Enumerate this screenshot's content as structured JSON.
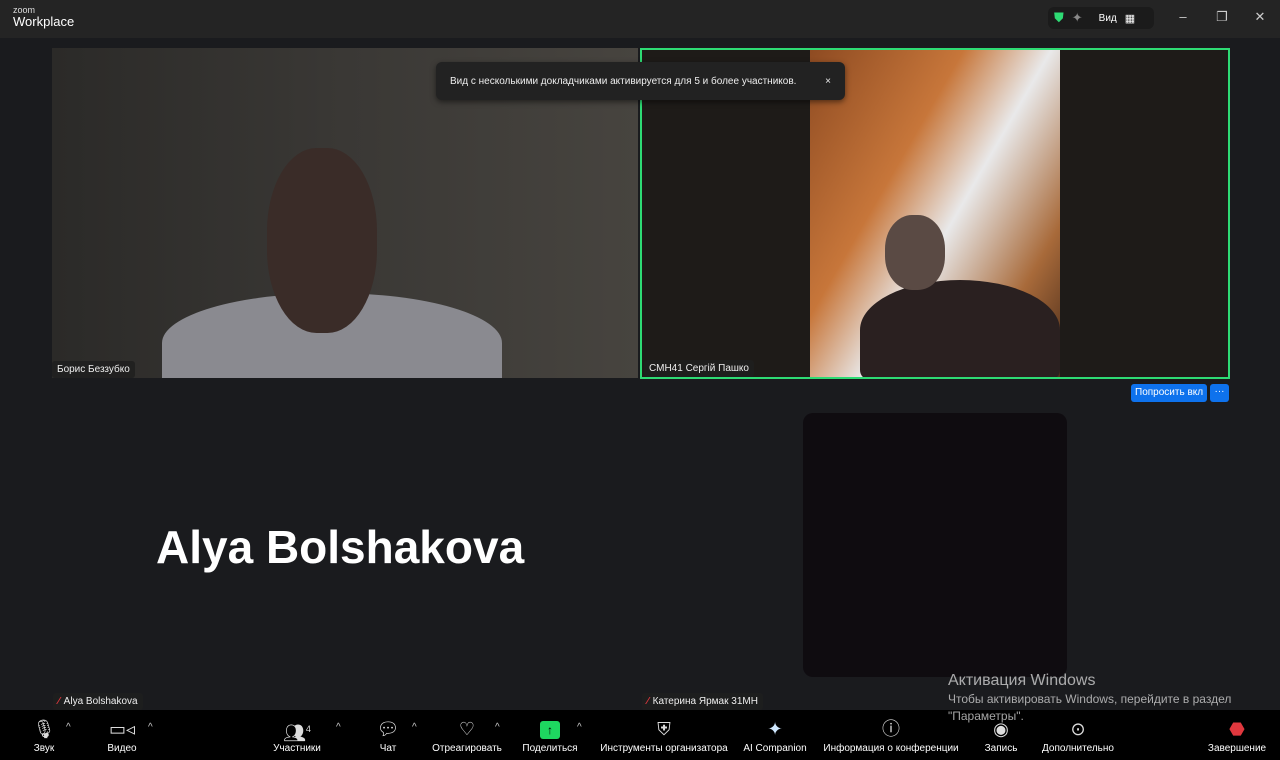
{
  "app": {
    "logo_small": "zoom",
    "logo_big": "Workplace",
    "view_label": "Вид"
  },
  "toast": {
    "text": "Вид с несколькими докладчиками активируется для 5 и более участников.",
    "close": "×"
  },
  "participants": [
    {
      "name": "Борис Беззубко"
    },
    {
      "name": "СМН41 Сергій Пашко"
    },
    {
      "name": "Alya Bolshakova",
      "muted": true
    },
    {
      "name": "Катерина Ярмак 31МН",
      "muted": true
    }
  ],
  "tile_actions": {
    "ask": "Попросить вкл",
    "more": "···"
  },
  "big_name": "Alya Bolshakova",
  "watermark": {
    "title": "Активация Windows",
    "line1": "Чтобы активировать Windows, перейдите в раздел",
    "line2": "\"Параметры\"."
  },
  "toolbar": {
    "audio": "Звук",
    "video": "Видео",
    "participants": "Участники",
    "participants_count": "4",
    "chat": "Чат",
    "react": "Отреагировать",
    "share": "Поделиться",
    "host_tools": "Инструменты организатора",
    "ai": "AI Companion",
    "info": "Информация о конференции",
    "record": "Запись",
    "more": "Дополнительно",
    "end": "Завершение"
  },
  "colors": {
    "active_speaker": "#2edb74",
    "accent": "#0e72ed",
    "share": "#1ed760",
    "end": "#e0383e"
  }
}
